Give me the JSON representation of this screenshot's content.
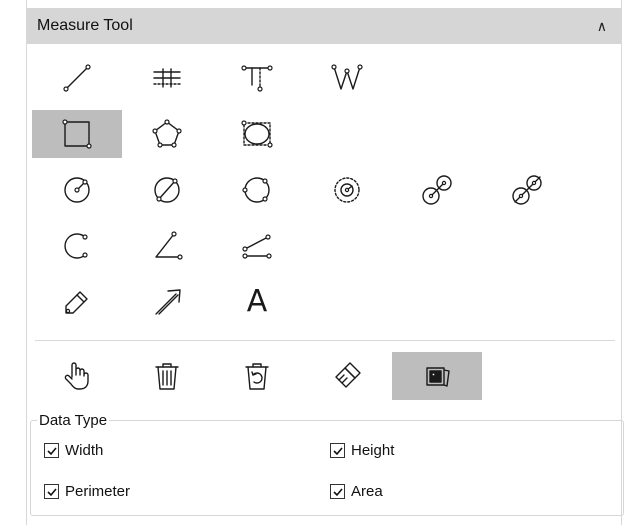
{
  "panel": {
    "title": "Measure Tool",
    "collapse_icon": "chevron-up-icon"
  },
  "tools": [
    {
      "name": "line-tool",
      "icon": "line-icon",
      "selected": false
    },
    {
      "name": "parallel-lines-tool",
      "icon": "parallel-lines-icon",
      "selected": false
    },
    {
      "name": "perpendicular-line-tool",
      "icon": "perpendicular-icon",
      "selected": false
    },
    {
      "name": "polyline-tool",
      "icon": "polyline-icon",
      "selected": false
    },
    {
      "name": "rectangle-tool",
      "icon": "rectangle-icon",
      "selected": true
    },
    {
      "name": "polygon-tool",
      "icon": "polygon-icon",
      "selected": false
    },
    {
      "name": "ellipse-tool",
      "icon": "ellipse-icon",
      "selected": false
    },
    {
      "name": "circle-radius-tool",
      "icon": "circle-radius-icon",
      "selected": false
    },
    {
      "name": "circle-diameter-tool",
      "icon": "circle-diameter-icon",
      "selected": false
    },
    {
      "name": "circle-three-point-tool",
      "icon": "circle-three-point-icon",
      "selected": false
    },
    {
      "name": "concentric-circles-tool",
      "icon": "concentric-circles-icon",
      "selected": false
    },
    {
      "name": "two-circles-distance-tool",
      "icon": "two-circles-icon",
      "selected": false
    },
    {
      "name": "two-circles-alt-tool",
      "icon": "two-circles-alt-icon",
      "selected": false
    },
    {
      "name": "arc-tool",
      "icon": "arc-icon",
      "selected": false
    },
    {
      "name": "angle-tool",
      "icon": "angle-icon",
      "selected": false
    },
    {
      "name": "line-angle-tool",
      "icon": "line-angle-icon",
      "selected": false
    },
    {
      "name": "pencil-tool",
      "icon": "pencil-icon",
      "selected": false
    },
    {
      "name": "arrow-tool",
      "icon": "arrow-icon",
      "selected": false
    },
    {
      "name": "text-tool",
      "icon": "text-icon",
      "label": "A",
      "selected": false
    }
  ],
  "actions": [
    {
      "name": "pan-button",
      "icon": "hand-icon",
      "selected": false
    },
    {
      "name": "delete-button",
      "icon": "trash-icon",
      "selected": false
    },
    {
      "name": "undo-delete-button",
      "icon": "restore-trash-icon",
      "selected": false
    },
    {
      "name": "clear-button",
      "icon": "broom-icon",
      "selected": false
    },
    {
      "name": "gallery-button",
      "icon": "photo-stack-icon",
      "selected": true
    }
  ],
  "data_type": {
    "legend": "Data Type",
    "options": [
      {
        "label": "Width",
        "checked": true
      },
      {
        "label": "Height",
        "checked": true
      },
      {
        "label": "Perimeter",
        "checked": true
      },
      {
        "label": "Area",
        "checked": true
      }
    ]
  }
}
